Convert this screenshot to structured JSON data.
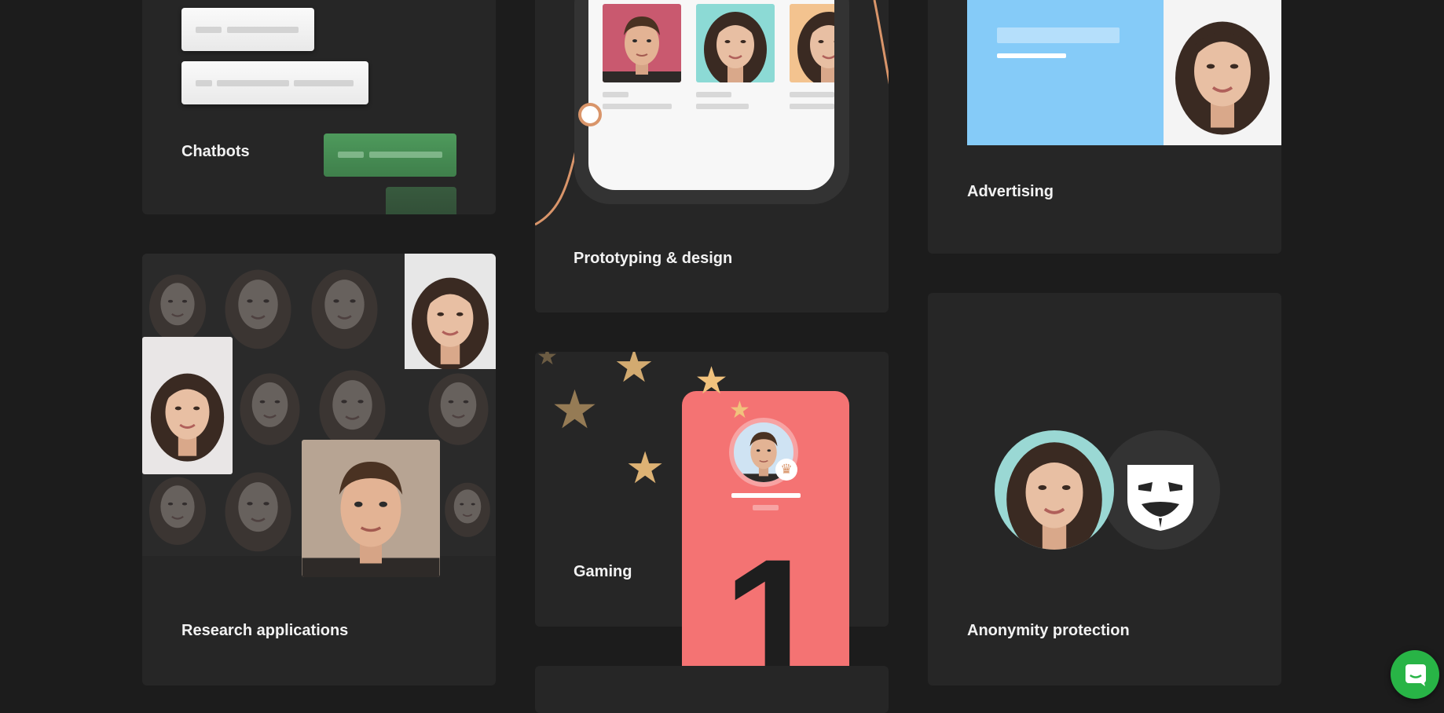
{
  "cards": {
    "chatbots": {
      "title": "Chatbots"
    },
    "prototyping": {
      "title": "Prototyping & design"
    },
    "advertising": {
      "title": "Advertising"
    },
    "research": {
      "title": "Research applications"
    },
    "gaming": {
      "title": "Gaming",
      "rank": "1"
    },
    "anonymity": {
      "title": "Anonymity protection"
    }
  },
  "chat_widget": {
    "icon": "chat-bubble-icon"
  },
  "colors": {
    "page_bg": "#1c1c1c",
    "card_bg": "#262626",
    "accent_orange": "#d9956a",
    "gaming_card": "#f47373",
    "ad_blue": "#85cbf8",
    "chat_green": "#28b446"
  }
}
